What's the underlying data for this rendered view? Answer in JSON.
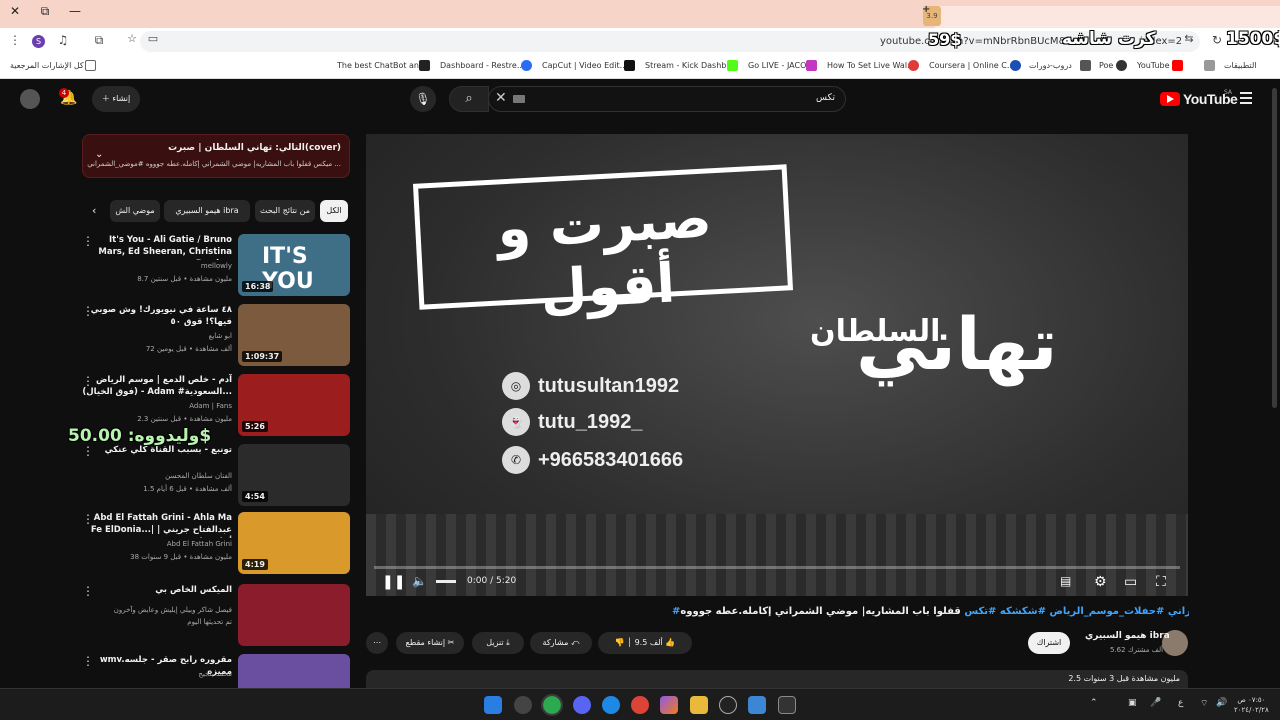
{
  "browser": {
    "window_controls": [
      "✕",
      "⧉",
      "—"
    ],
    "overlay_left": "كرت شاشه",
    "overlay_left_price": "59$",
    "overlay_right_price": "1500$",
    "overlay_plus": "+",
    "overlay_small": "3.9",
    "overlay_wallet": "وليدووه: 50.00$",
    "url_visible": "youtube.co",
    "url_visible2": "n?v=mNbrRbnBUcM&list",
    "url_visible3": "index=2",
    "profile_letter": "S"
  },
  "bookmarks": {
    "all_label": "كل الإشارات المرجعية",
    "items": [
      "التطبيقات",
      "YouTube",
      "Poe",
      "دروب-دورات",
      "Coursera | Online C...",
      "How To Set Live Wal...",
      "Go LIVE - JACO",
      "Stream - Kick Dashb...",
      "CapCut | Video Edit...",
      "Dashboard - Restre...",
      "The best ChatBot an..."
    ]
  },
  "youtube": {
    "logo_text": "YouTube",
    "logo_region": "SA",
    "search_value": "تكس",
    "create_label": "إنشاء",
    "notification_count": "4"
  },
  "player": {
    "card_title": "صبرت و أقول",
    "big_name": "تهاني",
    "sub_name": "السلطان",
    "socials": [
      "tutusultan1992",
      "tutu_1992_",
      "+966583401666"
    ],
    "time": "0:00 / 5:20",
    "progress": 0.0
  },
  "video": {
    "title_main": "قفلوا باب المشاريه| موضي الشمراني إكامله.عطه جوووه",
    "title_tags": "#موضي_الشمراني #حفلات_موسم_الرياض #شكشكه #تكس",
    "channel_name": "هيمو السبيري ibra",
    "channel_subs": "5.62 ألف مشترك",
    "subscribe": "اشتراك",
    "likes": "9.5 ألف",
    "share": "مشاركة",
    "download": "تنزيل",
    "clip": "إنشاء مقطع",
    "views_line": "2.5 مليون مشاهدة  قبل 3 سنوات"
  },
  "sidebar": {
    "next_title": "التالي: تهاني السلطان | صبرت(cover)",
    "next_sub": "ميكس قفلوا باب المشاريه| موضي الشمراني إكامله.عطه جوووه #موضي_الشمراني ...",
    "chips": [
      "الكل",
      "من نتائج البحث",
      "هيمو السبيري ibra",
      "موضي الش"
    ],
    "items": [
      {
        "title": "It's You - Ali Gatie / Bruno Mars, Ed Sheeran, Christina Perri,...",
        "channel": "mellowly",
        "meta": "8.7 مليون مشاهدة • قبل سنتين",
        "duration": "16:38",
        "thumb": "#3f6f86"
      },
      {
        "title": "٤٨ ساعة في نيويورك! وش صوبي فيها؟! قوق ٥٠",
        "channel": "ابو شايع",
        "meta": "72 ألف مشاهدة • قبل يومين",
        "duration": "1:09:37",
        "thumb": "#7b5a3e"
      },
      {
        "title": "آدم - خلص الدمع | موسم الرياض (فوق الخيال) - Adam #السعودية...",
        "channel": "Adam | Fans",
        "meta": "2.3 مليون مشاهدة • قبل سنتين",
        "duration": "5:26",
        "thumb": "#9b1d1d"
      },
      {
        "title": "تونبع - بسبب القناة كلي عنكي",
        "channel": "الفنان سلطان المحسن",
        "meta": "1.5 ألف مشاهدة • قبل 6 أيام",
        "duration": "4:54",
        "thumb": "#2b2b2b"
      },
      {
        "title": "Abd El Fattah Grini - Ahla Ma Fe ElDonia...| عبدالفتاح جريني | أحلى ما في",
        "channel": "Abd El Fattah Grini",
        "meta": "38 مليون مشاهدة • قبل 9 سنوات",
        "duration": "4:19",
        "thumb": "#d99a2b"
      },
      {
        "title": "الميكس الخاص بي",
        "channel": "فيصل شاكر وبيلي إيليش وعايض وآخرون",
        "meta": "تم تحديثها اليوم",
        "duration": "",
        "thumb": "#8a1c2c"
      },
      {
        "title": "wmv.مقروره رابح صقر - جلسه مميزه",
        "channel": "محمد بلجيج",
        "meta": "",
        "duration": "",
        "thumb": "#6a4fa0"
      }
    ]
  },
  "taskbar": {
    "time": "٠٧:٥٠ ص",
    "date": "٢٠٢٤/٠٢/٢٨",
    "lang": "ع"
  }
}
